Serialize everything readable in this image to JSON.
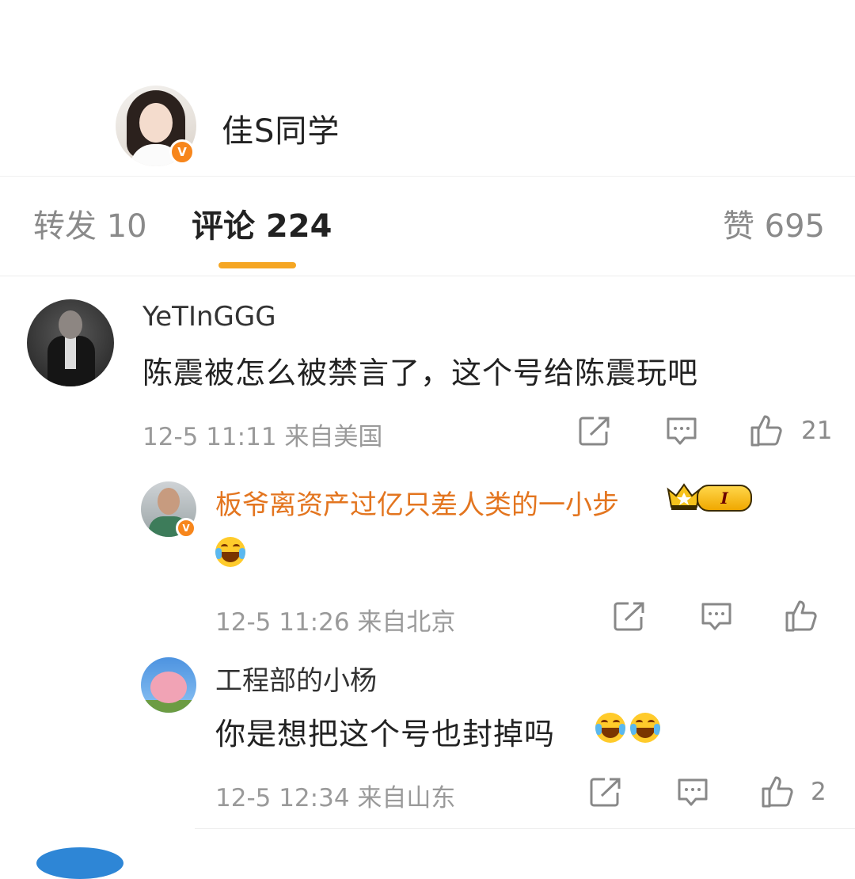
{
  "author": {
    "name": "佳S同学",
    "badge": "V"
  },
  "tabs": {
    "repost": "转发 10",
    "comment": "评论 224",
    "like": "赞 695"
  },
  "comments": [
    {
      "user": "YeTInGGG",
      "text": "陈震被怎么被禁言了，这个号给陈震玩吧",
      "meta": "12-5 11:11  来自美国",
      "like_count": "21"
    },
    {
      "user": "板爷离资产过亿只差人类的一小步",
      "badge": "V",
      "level": "I",
      "text_emoji": "laughing-tears",
      "meta": "12-5 11:26  来自北京",
      "like_count": ""
    },
    {
      "user": "工程部的小杨",
      "text": "你是想把这个号也封掉吗",
      "meta": "12-5 12:34  来自山东",
      "like_count": "2"
    }
  ],
  "icons": {
    "share": "share-icon",
    "reply": "comment-icon",
    "like": "thumbs-up-icon"
  },
  "colors": {
    "accent": "#f5a623",
    "vip_name": "#e3751f",
    "verified": "#f7861c"
  }
}
